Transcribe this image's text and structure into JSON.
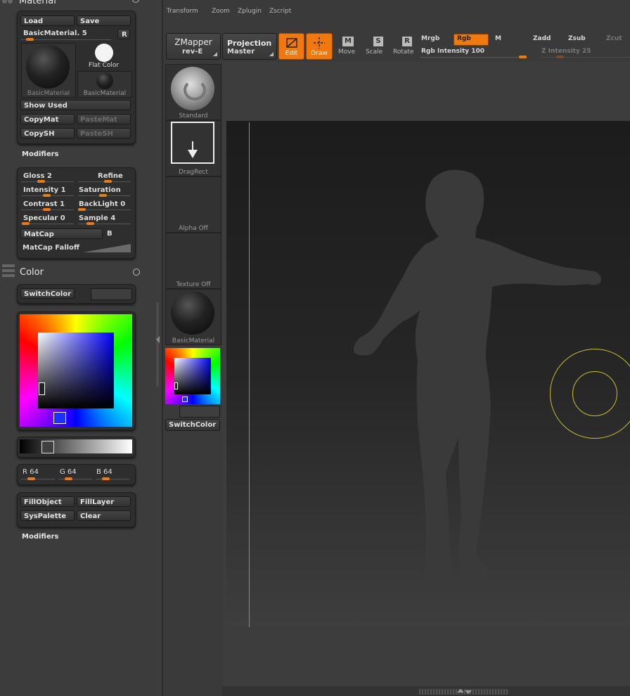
{
  "menu": [
    "Transform",
    "Zoom",
    "Zplugin",
    "Zscript"
  ],
  "material": {
    "title": "Material",
    "load": "Load",
    "save": "Save",
    "current": "BasicMaterial. 5",
    "r": "R",
    "flat_color": "Flat Color",
    "thumb1": "BasicMaterial",
    "thumb2": "BasicMaterial",
    "show_used": "Show Used",
    "copymat": "CopyMat",
    "pastemat": "PasteMat",
    "copysh": "CopySH",
    "pastesh": "PasteSH"
  },
  "modifiers": {
    "title": "Modifiers",
    "gloss": "Gloss 2",
    "refine": "Refine",
    "intensity": "Intensity 1",
    "saturation": "Saturation",
    "contrast": "Contrast 1",
    "backlight": "BackLight 0",
    "specular": "Specular 0",
    "sample": "Sample 4",
    "matcap": "MatCap",
    "b": "B",
    "matcap_falloff": "MatCap Falloff"
  },
  "color": {
    "title": "Color",
    "switchcolor": "SwitchColor",
    "r": "R 64",
    "g": "G 64",
    "b": "B 64",
    "fillobject": "FillObject",
    "filllayer": "FillLayer",
    "syspalette": "SysPalette",
    "clear": "Clear",
    "modifiers": "Modifiers",
    "main_color": "#404040"
  },
  "toolbar": {
    "zmapper": "ZMapper",
    "zmapper_sub": "rev-E",
    "projection": "Projection",
    "projection_sub": "Master",
    "edit": "Edit",
    "draw": "Draw",
    "move": "Move",
    "scale": "Scale",
    "rotate": "Rotate",
    "mrgb": "Mrgb",
    "rgb": "Rgb",
    "m": "M",
    "rgb_intensity": "Rgb Intensity 100",
    "zadd": "Zadd",
    "zsub": "Zsub",
    "zcut": "Zcut",
    "z_intensity": "Z Intensity 25"
  },
  "shelf": {
    "brush": "Standard",
    "stroke": "DragRect",
    "alpha": "Alpha Off",
    "texture": "Texture Off",
    "material": "BasicMaterial",
    "switchcolor": "SwitchColor"
  },
  "colors": {
    "accent": "#f0780e",
    "cursor": "#c8c030"
  }
}
